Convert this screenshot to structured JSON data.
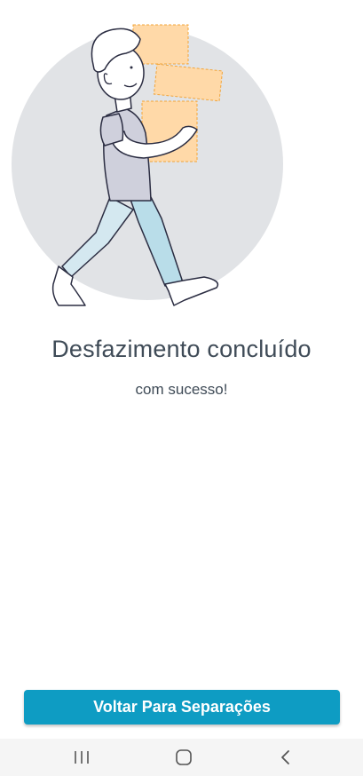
{
  "result": {
    "title": "Desfazimento concluído",
    "subtitle": "com sucesso!"
  },
  "actions": {
    "back_label": "Voltar Para Separações"
  },
  "illustration": {
    "icon": "person-carrying-boxes-illustration"
  },
  "system_nav": {
    "recent_apps": "recent-apps-icon",
    "home": "home-icon",
    "back": "back-icon"
  },
  "colors": {
    "primary": "#0e9cc3",
    "text": "#3f4b57",
    "circle": "#e1e3e6",
    "box": "#ffd9a8",
    "box_outline": "#f2a53a"
  }
}
